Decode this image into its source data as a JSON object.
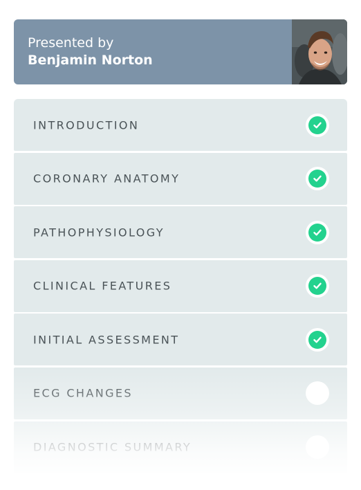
{
  "presenter": {
    "sub_label": "Presented by",
    "name": "Benjamin Norton",
    "avatar_icon": "presenter-photo"
  },
  "lessons": [
    {
      "label": "INTRODUCTION",
      "status": "complete"
    },
    {
      "label": "CORONARY ANATOMY",
      "status": "complete"
    },
    {
      "label": "PATHOPHYSIOLOGY",
      "status": "complete"
    },
    {
      "label": "CLINICAL FEATURES",
      "status": "complete"
    },
    {
      "label": "INITIAL ASSESSMENT",
      "status": "complete"
    },
    {
      "label": "ECG CHANGES",
      "status": "incomplete"
    },
    {
      "label": "DIAGNOSTIC SUMMARY",
      "status": "incomplete"
    }
  ],
  "colors": {
    "presenter_bg": "#7d93a8",
    "row_bg": "#e2eaeb",
    "check_green": "#23d28e",
    "label_text": "#4a5357"
  }
}
